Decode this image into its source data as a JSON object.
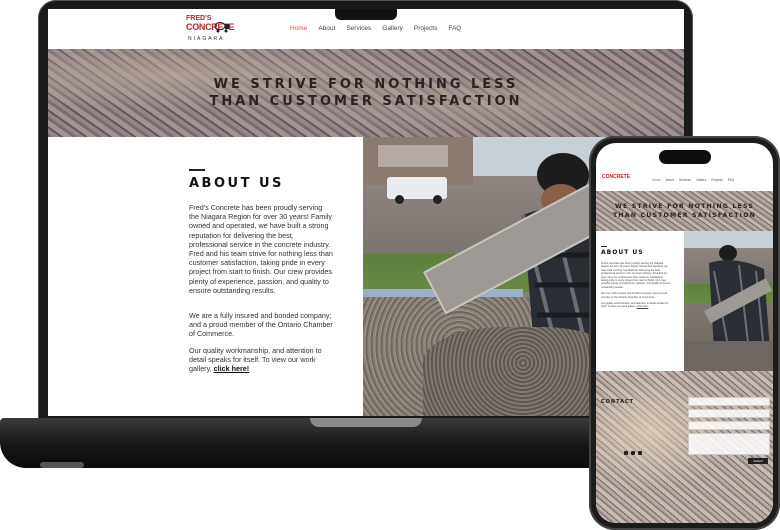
{
  "site": {
    "logo": {
      "line1": "FRED'S",
      "line2": "CONCRETE",
      "line3": "NIAGARA"
    },
    "nav": {
      "items": [
        {
          "label": "Home",
          "active": true
        },
        {
          "label": "About",
          "active": false
        },
        {
          "label": "Services",
          "active": false
        },
        {
          "label": "Gallery",
          "active": false
        },
        {
          "label": "Projects",
          "active": false
        },
        {
          "label": "FAQ",
          "active": false
        }
      ]
    },
    "hero": {
      "line1": "WE STRIVE FOR NOTHING LESS",
      "line2": "THAN CUSTOMER SATISFACTION"
    },
    "about": {
      "heading": "ABOUT US",
      "paragraph1": "Fred's Concrete has been proudly serving the Niagara Region for over 30 years! Family owned and operated, we have built a strong reputation for delivering the best, professional service in the concrete industry. Fred and his team strive for nothing less than customer satisfaction, taking pride in every project from start to finish. Our crew provides plenty of experience, passion, and quality to ensure outstanding results.",
      "paragraph2": "We are a fully insured and bonded company; and a proud member of the Ontario Chamber of Commerce.",
      "paragraph3_prefix": "Our quality workmanship, and attention to detail speaks for itself. To view our work gallery, ",
      "link_label": "click here!"
    },
    "contact": {
      "heading": "CONTACT",
      "submit_label": "Submit"
    }
  },
  "colors": {
    "accent": "#d9503f",
    "brand_red": "#c42026",
    "text": "#333333"
  }
}
